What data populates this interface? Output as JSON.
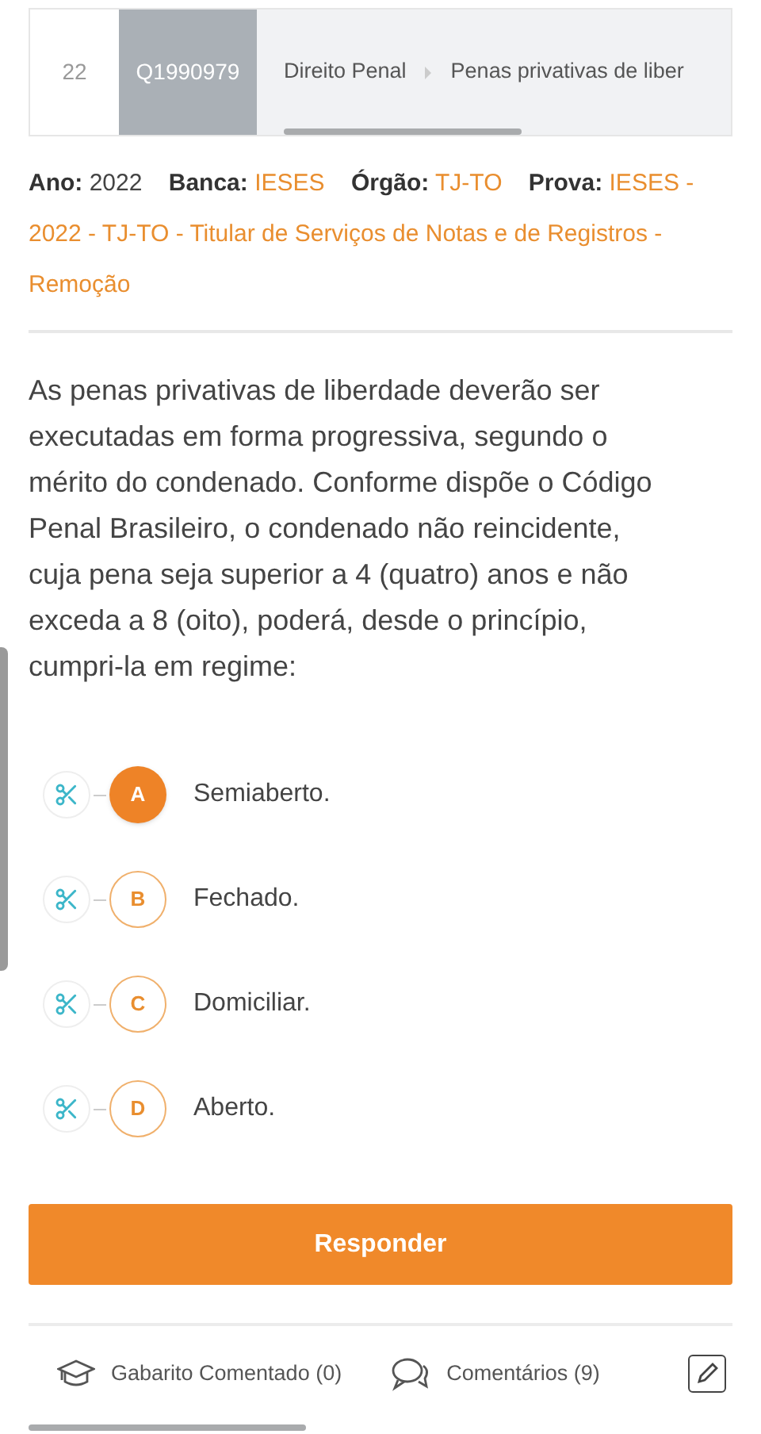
{
  "header": {
    "number": "22",
    "question_id": "Q1990979",
    "breadcrumb": [
      "Direito Penal",
      "Penas privativas de liber"
    ]
  },
  "meta": [
    {
      "label": "Ano:",
      "value": "2022",
      "link": false
    },
    {
      "label": "Banca:",
      "value": "IESES",
      "link": true
    },
    {
      "label": "Órgão:",
      "value": "TJ-TO",
      "link": true
    },
    {
      "label": "Prova:",
      "value": "IESES - 2022 - TJ-TO - Titular de Serviços de Notas e de Registros - Remoção",
      "link": true
    }
  ],
  "question": "As penas privativas de liberdade deverão ser executadas em forma progressiva, segundo o mérito do condenado. Conforme dispõe o Código Penal Brasileiro, o condenado não reincidente, cuja pena seja superior a 4 (quatro) anos e não exceda a 8 (oito), poderá, desde o princípio, cumpri-la em regime:",
  "options": [
    {
      "letter": "A",
      "text": "Semiaberto.",
      "selected": true
    },
    {
      "letter": "B",
      "text": "Fechado.",
      "selected": false
    },
    {
      "letter": "C",
      "text": "Domiciliar.",
      "selected": false
    },
    {
      "letter": "D",
      "text": "Aberto.",
      "selected": false
    }
  ],
  "submit_button": "Responder",
  "footer": {
    "answer_tab": "Gabarito Comentado (0)",
    "comments_tab": "Comentários (9)"
  }
}
